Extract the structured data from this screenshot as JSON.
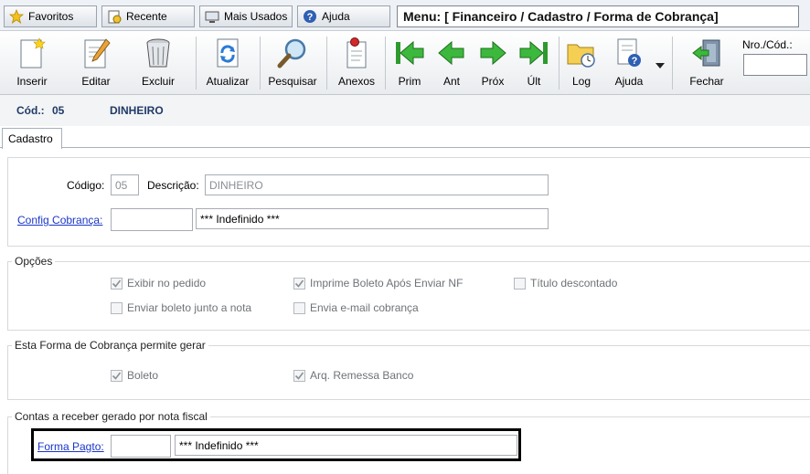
{
  "topbar": {
    "favoritos": "Favoritos",
    "recente": "Recente",
    "mais_usados": "Mais Usados",
    "ajuda": "Ajuda",
    "menu_path": "Menu: [ Financeiro / Cadastro / Forma de Cobrança]"
  },
  "toolbar": {
    "inserir": "Inserir",
    "editar": "Editar",
    "excluir": "Excluir",
    "atualizar": "Atualizar",
    "pesquisar": "Pesquisar",
    "anexos": "Anexos",
    "prim": "Prim",
    "ant": "Ant",
    "prox": "Próx",
    "ult": "Últ",
    "log": "Log",
    "ajuda": "Ajuda",
    "fechar": "Fechar",
    "nro_label": "Nro./Cód.:",
    "nro_value": ""
  },
  "record": {
    "cod_label": "Cód.:",
    "cod_value": "05",
    "name": "DINHEIRO"
  },
  "tabs": {
    "cadastro": "Cadastro"
  },
  "form": {
    "codigo_label": "Código:",
    "codigo_value": "05",
    "descricao_label": "Descrição:",
    "descricao_value": "DINHEIRO",
    "config_label": "Config Cobrança:",
    "config_code": "",
    "config_desc": "*** Indefinido ***"
  },
  "opcoes": {
    "title": "Opções",
    "exibir_pedido": "Exibir no pedido",
    "imprime_boleto": "Imprime Boleto Após Enviar NF",
    "titulo_descontado": "Título descontado",
    "enviar_boleto": "Enviar boleto junto a nota",
    "envia_email": "Envia e-mail cobrança"
  },
  "gerar": {
    "title": "Esta Forma de Cobrança permite gerar",
    "boleto": "Boleto",
    "arq_remessa": "Arq. Remessa Banco"
  },
  "contas": {
    "title": "Contas a receber gerado por nota fiscal",
    "forma_pagto_label": "Forma Pagto:",
    "forma_pagto_code": "",
    "forma_pagto_desc": "*** Indefinido ***"
  }
}
